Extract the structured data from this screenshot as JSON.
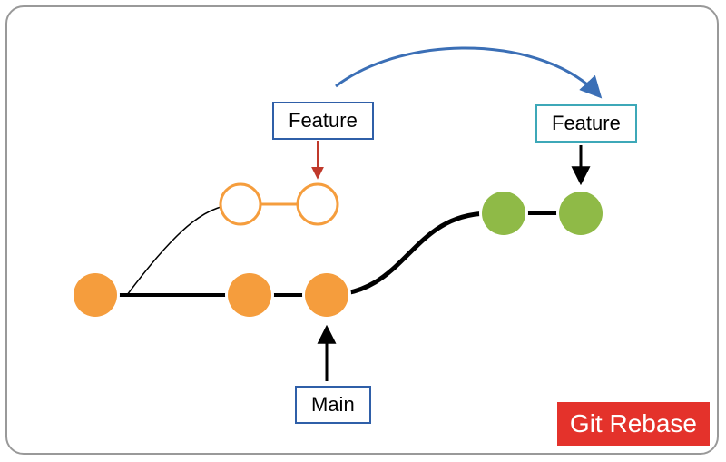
{
  "labels": {
    "feature_old": "Feature",
    "feature_new": "Feature",
    "main": "Main"
  },
  "title": "Git Rebase",
  "colors": {
    "commit_main": "#F59D3D",
    "commit_outline": "#F59D3D",
    "commit_rebased": "#8FBA47",
    "label_border_blue": "#2F5FA8",
    "label_border_teal": "#3DA8B8",
    "arrow_red": "#C0392B",
    "arrow_black": "#000000",
    "arrow_blue": "#3B6FB6",
    "title_bg": "#E4322B"
  },
  "diagram": {
    "description": "Git rebase moves feature branch commits to tip of main",
    "main_commits": 3,
    "old_feature_commits": 2,
    "new_feature_commits": 2,
    "old_feature_filled": false,
    "new_feature_filled": true
  }
}
